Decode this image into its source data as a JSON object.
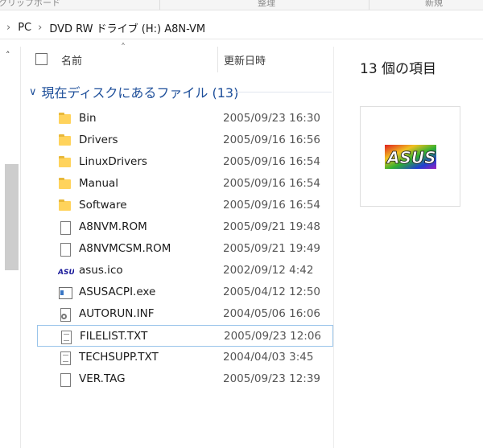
{
  "ribbon": {
    "left_text": "クリップボード",
    "mid_text": "整理",
    "right_text": "新規"
  },
  "address": {
    "crumbs": [
      "PC",
      "DVD RW ドライブ (H:) A8N-VM"
    ]
  },
  "columns": {
    "name": "名前",
    "date": "更新日時"
  },
  "group": {
    "label": "現在ディスクにあるファイル (13)"
  },
  "files": [
    {
      "name": "Bin",
      "date": "2005/09/23 16:30",
      "icon": "folder-icon"
    },
    {
      "name": "Drivers",
      "date": "2005/09/16 16:56",
      "icon": "folder-icon"
    },
    {
      "name": "LinuxDrivers",
      "date": "2005/09/16 16:54",
      "icon": "folder-icon"
    },
    {
      "name": "Manual",
      "date": "2005/09/16 16:54",
      "icon": "folder-icon"
    },
    {
      "name": "Software",
      "date": "2005/09/16 16:54",
      "icon": "folder-icon"
    },
    {
      "name": "A8NVM.ROM",
      "date": "2005/09/21 19:48",
      "icon": "file-icon"
    },
    {
      "name": "A8NVMCSM.ROM",
      "date": "2005/09/21 19:49",
      "icon": "file-icon"
    },
    {
      "name": "asus.ico",
      "date": "2002/09/12 4:42",
      "icon": "asus-icon"
    },
    {
      "name": "ASUSACPI.exe",
      "date": "2005/04/12 12:50",
      "icon": "exe-icon"
    },
    {
      "name": "AUTORUN.INF",
      "date": "2004/05/06 16:06",
      "icon": "settings-file-icon"
    },
    {
      "name": "FILELIST.TXT",
      "date": "2005/09/23 12:06",
      "icon": "text-file-icon"
    },
    {
      "name": "TECHSUPP.TXT",
      "date": "2004/04/03 3:45",
      "icon": "text-file-icon"
    },
    {
      "name": "VER.TAG",
      "date": "2005/09/23 12:39",
      "icon": "file-icon"
    }
  ],
  "details": {
    "count_text": "13 個の項目"
  },
  "colors": {
    "group_text": "#1e4f9a",
    "folder": "#ffd35c",
    "focus_border": "#99c4ea"
  }
}
